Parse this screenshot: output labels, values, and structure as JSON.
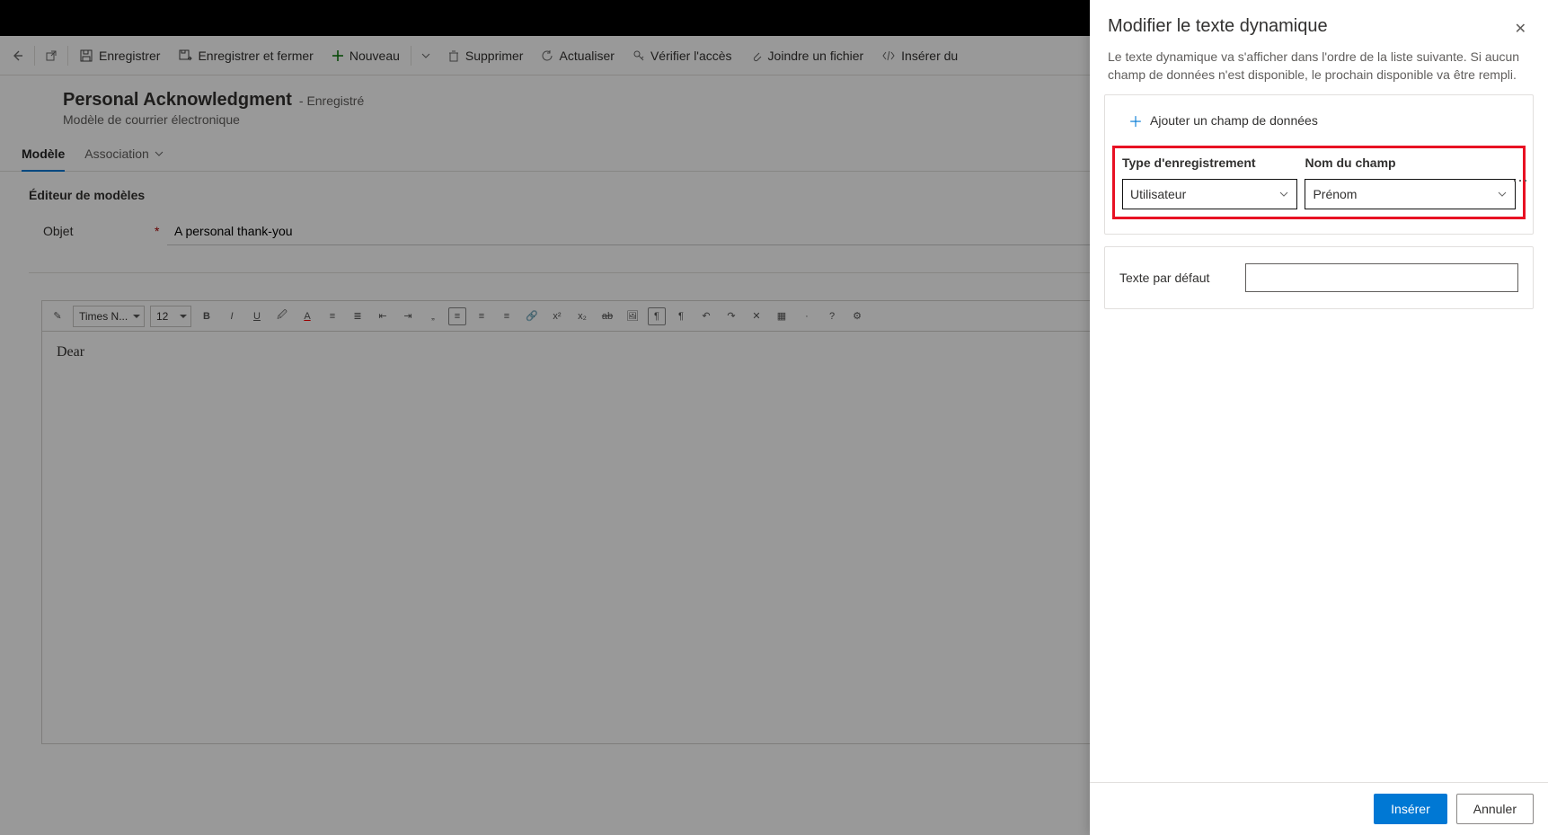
{
  "commandbar": {
    "save": "Enregistrer",
    "save_close": "Enregistrer et fermer",
    "new": "Nouveau",
    "delete": "Supprimer",
    "refresh": "Actualiser",
    "check_access": "Vérifier l'accès",
    "attach_file": "Joindre un fichier",
    "insert_dynamic": "Insérer du"
  },
  "header": {
    "title": "Personal Acknowledgment",
    "state_prefix": "- ",
    "state": "Enregistré",
    "subtitle": "Modèle de courrier électronique"
  },
  "tabs": {
    "model": "Modèle",
    "association": "Association"
  },
  "editor": {
    "section_title": "Éditeur de modèles",
    "subject_label": "Objet",
    "subject_value": "A personal thank-you",
    "body": "Dear",
    "font_name": "Times N...",
    "font_size": "12"
  },
  "panel": {
    "title": "Modifier le texte dynamique",
    "description": "Le texte dynamique va s'afficher dans l'ordre de la liste suivante. Si aucun champ de données n'est disponible, le prochain disponible va être rempli.",
    "add_field": "Ajouter un champ de données",
    "record_type_label": "Type d'enregistrement",
    "field_name_label": "Nom du champ",
    "record_type_value": "Utilisateur",
    "field_name_value": "Prénom",
    "default_text_label": "Texte par défaut",
    "insert": "Insérer",
    "cancel": "Annuler"
  }
}
